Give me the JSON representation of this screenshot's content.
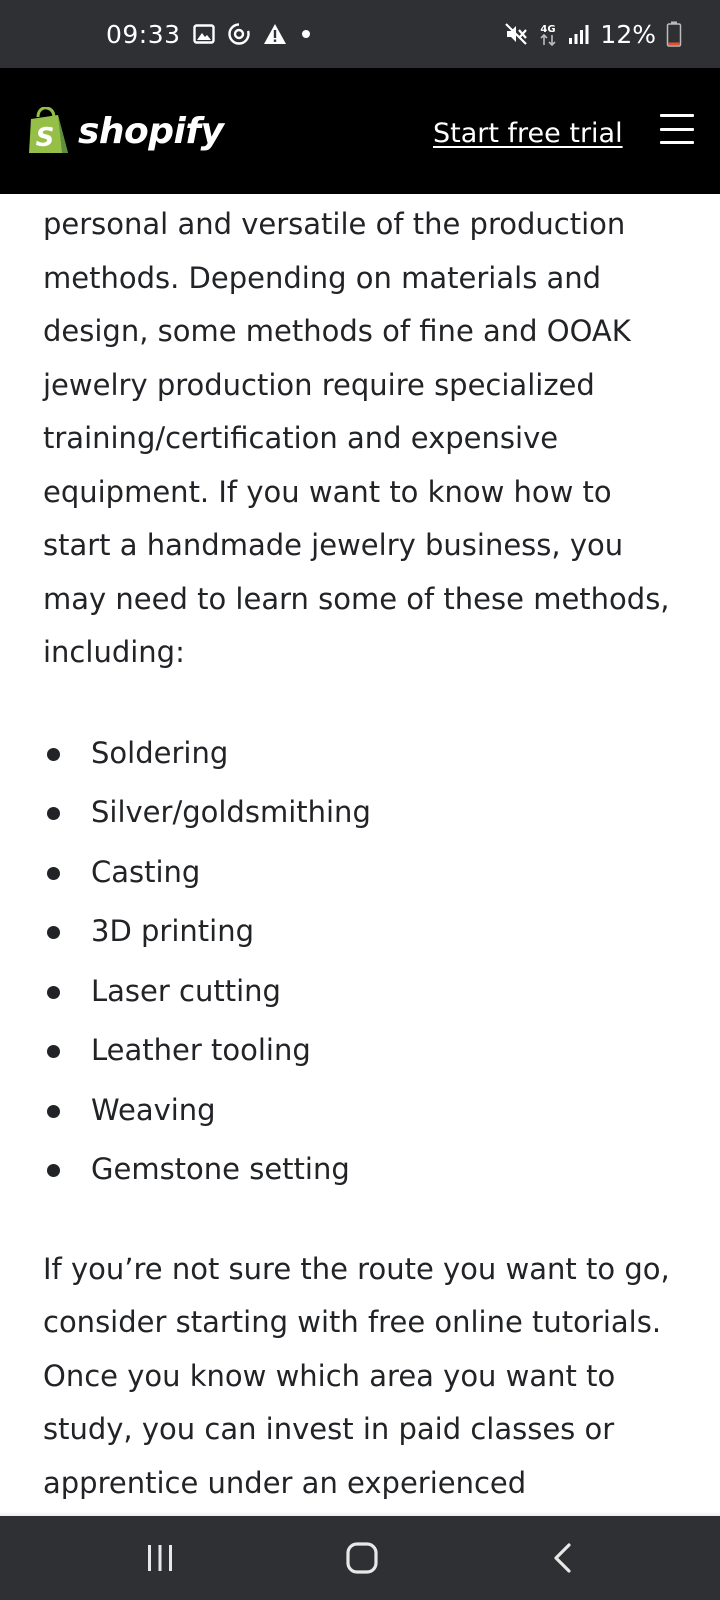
{
  "status_bar": {
    "time": "09:33",
    "left_icons": [
      "gallery-icon",
      "sync-icon",
      "warning-icon",
      "dot-icon"
    ],
    "right_icons": [
      "mute-icon",
      "4g-icon",
      "signal-icon"
    ],
    "network_label": "4G",
    "battery_percent": "12%",
    "battery_level": 0.12,
    "battery_color": "#e8502b"
  },
  "header": {
    "logo_text": "shopify",
    "logo_color": "#95bf47",
    "cta_label": "Start free trial",
    "menu_icon": "hamburger-menu-icon"
  },
  "article": {
    "intro_paragraph": "personal and versatile of the production methods. Depending on materials and design, some methods of fine and OOAK jewelry production require specialized training/certification and expensive equipment. If you want to know how to start a handmade jewelry business, you may need to learn some of these methods, including:",
    "methods": [
      "Soldering",
      "Silver/goldsmithing",
      "Casting",
      "3D printing",
      "Laser cutting",
      "Leather tooling",
      "Weaving",
      "Gemstone setting"
    ],
    "closing_paragraph": "If you’re not sure the route you want to go, consider starting with free online tutorials. Once you know which area you want to study, you can invest in paid classes or apprentice under an experienced"
  },
  "navigation_bar": {
    "buttons": [
      "recent-apps-icon",
      "home-icon",
      "back-icon"
    ]
  }
}
